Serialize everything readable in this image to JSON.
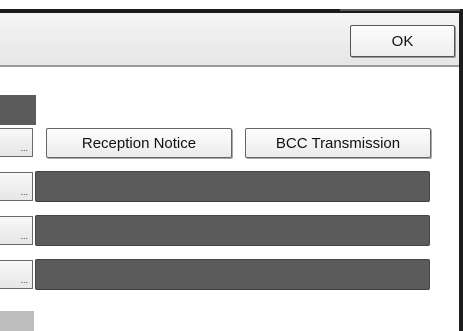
{
  "header": {
    "ok_label": "OK"
  },
  "options": {
    "reception_notice_label": "Reception Notice",
    "bcc_transmission_label": "BCC Transmission"
  },
  "rows": {
    "ellipsis": "..."
  }
}
